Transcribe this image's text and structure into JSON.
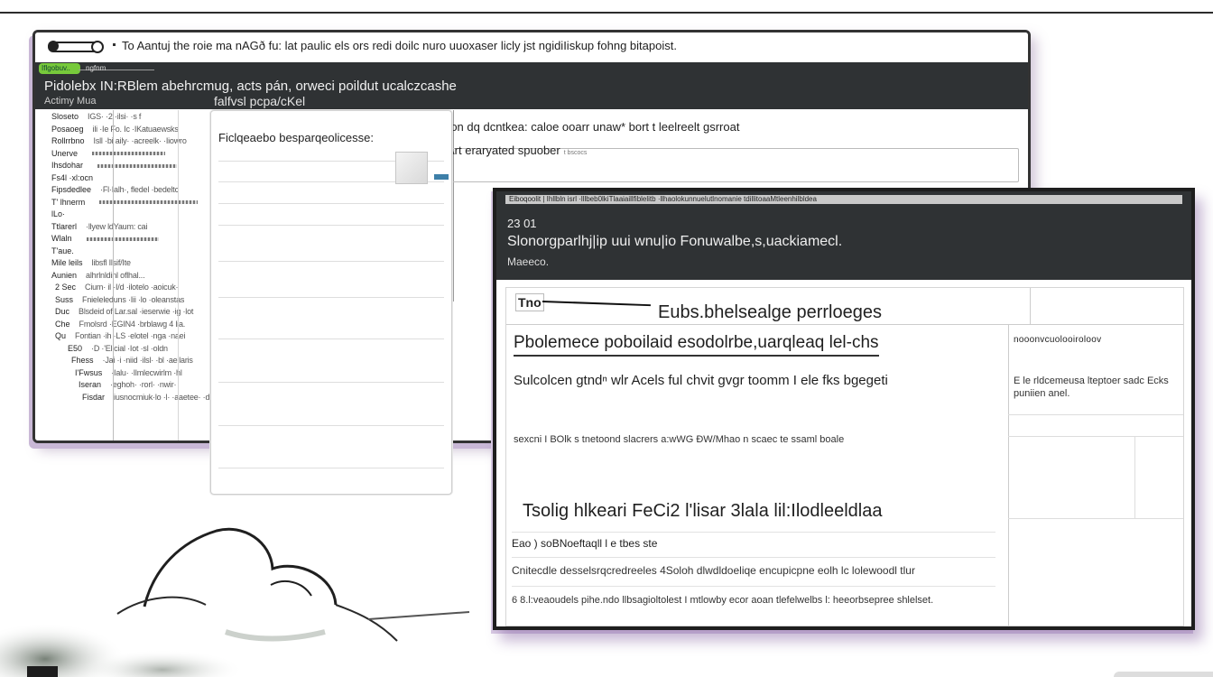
{
  "window_a": {
    "title": "To Aantuj  the roie ma nAGð fu: lat paulic els ors redi doilc nuro uuoxaser licly jst ngidiIiskup fohng bitapoist.",
    "tab_label": "Iflgobuv..",
    "band_small": "ngfnm",
    "headline": "Pidolebx  IN:RBlem  abehrcmug, acts  pán,  orweci  poildut  ucalczcashe",
    "subhead": "Actimy  Mua",
    "subhead2": "falfvsl  pcpa/cKel",
    "sidebar_rows": [
      {
        "label": "Sloseto",
        "value": "IGS· ·2  ·ilsi·  ·s f"
      },
      {
        "label": "Posaoeg",
        "value": "ili  ·Ie  Fo. Ic  ·IKatuaewsks"
      },
      {
        "label": "Rollrrbno",
        "value": "Isll ·bi  aily·  ·acreelk·  ·Iiowro"
      },
      {
        "label": "Unerve",
        "value": ""
      },
      {
        "label": "Ihsdohar",
        "value": ""
      },
      {
        "label": "Fs4l ·xl:ocn",
        "value": ""
      },
      {
        "label": "Fipsdedlee",
        "value": "·Fl·Ialh·, fledel ·bedeltc"
      },
      {
        "label": "T'  lhnerm",
        "value": ""
      },
      {
        "label": "lLo·",
        "value": ""
      },
      {
        "label": "Ttlarerl",
        "value": "·llyew  ldYaum:  cai"
      },
      {
        "label": "Wlaln",
        "value": ""
      },
      {
        "label": "T'aue.",
        "value": ""
      },
      {
        "label": "Mile   leils",
        "value": "libsfl  Ilsif/Ite"
      },
      {
        "label": "Aunien",
        "value": "alhrlnldinl  oflhal..."
      },
      {
        "label": "2 Sec",
        "value": "Cium·  il  ·I/d ·ilotelo  ·aoicuk·"
      },
      {
        "label": "Suss",
        "value": "Fnieleleduns  ·Iii  ·lo  ·oleanstas"
      },
      {
        "label": "Duc",
        "value": "Blsdeid  of  Lar.sal  ·ieserwie  ·ig  ·lot"
      },
      {
        "label": "Che",
        "value": "Fmolsrd  ·EGIN4 ·brblawg 4 lia."
      },
      {
        "label": "Qu",
        "value": "Fontian  ·ih  ·LS  ·elotel  ·nga  ·naei"
      },
      {
        "label": "E50",
        "value": "·D ·'Elicial  ·Iot  ·sl  ·oldn"
      },
      {
        "label": "Fhess",
        "value": "·Jai  ·i  ·niid  ·ilsl·  ·bl  ·aeilaris"
      },
      {
        "label": "I'Fwsus",
        "value": "·Ialu·  ·Ilmlecwirlm  ·hl"
      },
      {
        "label": "Iseran",
        "value": "·eghoh·  ·rorl·  ·nwir·"
      },
      {
        "label": "Fisdar",
        "value": "iusnocmiuk·lo  ·l·  ·aaetee·  ·drn"
      }
    ],
    "right_text_1": "ron dq dcntkea: caloe        ooarr unaw* bort t leelreelt gsrroat",
    "right_text_2": "Art eraryated spuober",
    "right_text_2_small": "t bscocs"
  },
  "panel_b": {
    "label": "Ficlqeaebo besparqeolicesse:"
  },
  "window_c": {
    "tabstrip": "Eiboqoolit  |  Ihllbln  isrl  ·lllbeb0lkiTlaaiaillfiblelitb  ·llhaolokunnuelutlnomanie  tdillitoaaMtleenhilbldea",
    "number": "23 01",
    "band_title": "Slonorgparlhj|ip uui wnu|io Fonuwalbe,s,uackiamecl.",
    "band_sub": "Maeeco.",
    "header_cell": "Tno",
    "doc_title": "Eubs.bhelsealge perrloeges",
    "heading": "Pbolemece  poboilaid  esodolrbe,uarqleaq  lel-chs",
    "side_header": "nooonvcuolooiroloov",
    "para": "Sulcolcen  gtndⁿ  wlr  Acels  ful  chvit  gvgr  toomm  I  ele  fks  bgegeti",
    "side_text": "E le rldcemeusa lteptoer sadc  Ecks  puniien anel.",
    "small1": "sexcni I BOlk s tnetoond  slacrers a:wWG  ÐW/Mhao n scaec  te ssaml  boale",
    "h2": "Tsolig  hlkeari  FeCi2 l'lisar  3lala  lil:Ilodleeldlaa",
    "line1": "Eao )  soBNoeftaqll   l e tbes ste",
    "line2": "Cnitecdle  desselsrqcredreeles  4Soloh  dlwdldoeliqe  encupicpne  eolh  lc  lolewoodl  tlur",
    "line3": "6 8.l:veaoudels pihe.ndo llbsagioltolest I mtlowby  ecor aoan  tlefelwelbs  l:  heeorbsepree  shlelset."
  },
  "colors": {
    "band_dark": "#2f3234",
    "accent_green": "#77c93b",
    "accent_blue": "#3d7fa8",
    "shadow_purple": "#c9b8d6"
  }
}
